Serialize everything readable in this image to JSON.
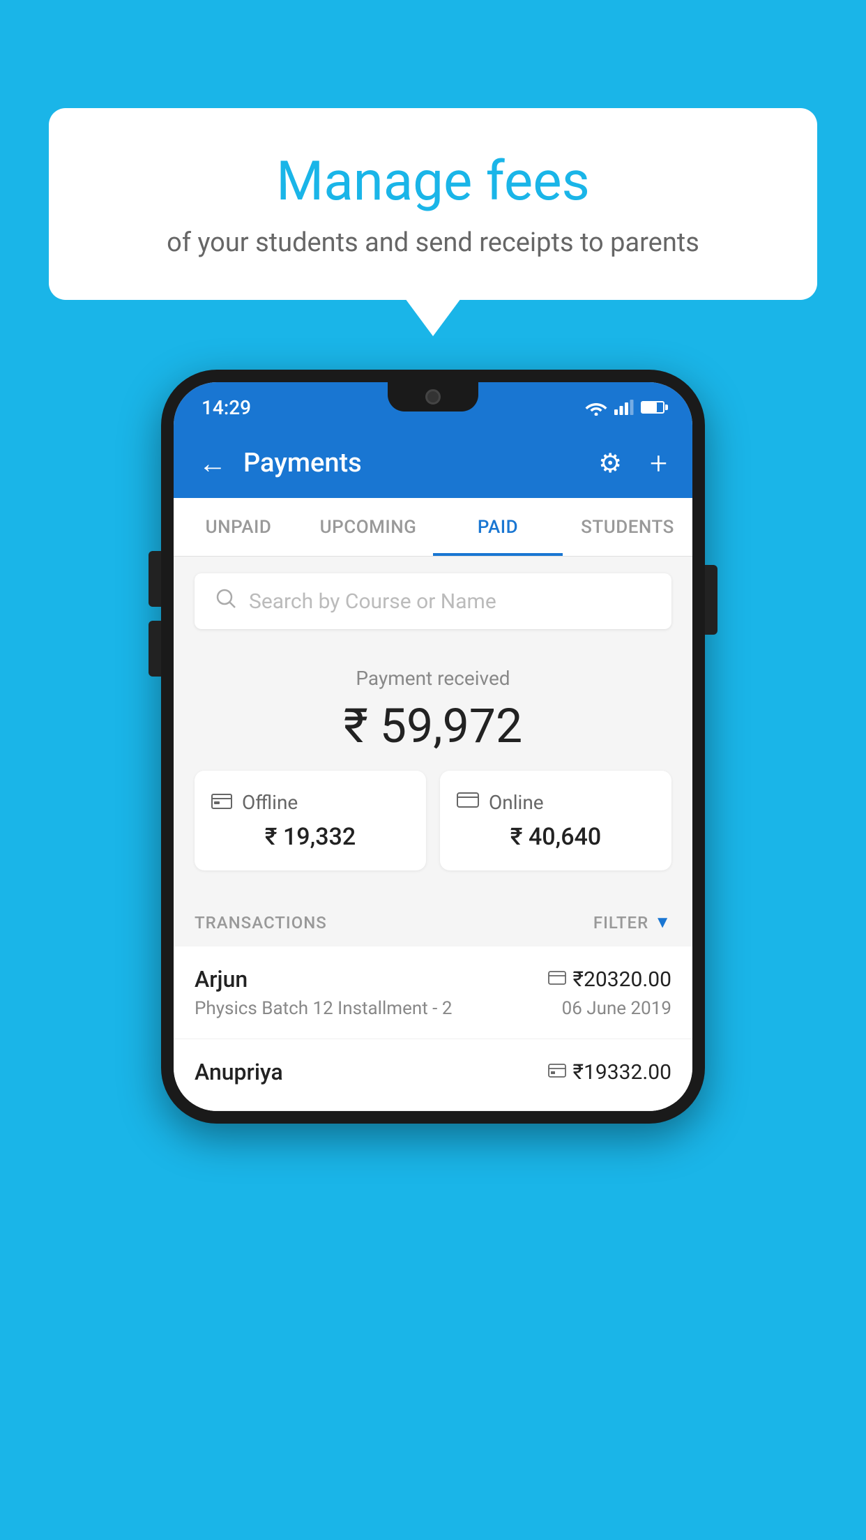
{
  "background": {
    "color": "#1ab5e8"
  },
  "speech_bubble": {
    "title": "Manage fees",
    "subtitle": "of your students and send receipts to parents"
  },
  "status_bar": {
    "time": "14:29"
  },
  "app_header": {
    "title": "Payments",
    "back_label": "←",
    "settings_label": "⚙",
    "add_label": "+"
  },
  "tabs": [
    {
      "label": "UNPAID",
      "active": false
    },
    {
      "label": "UPCOMING",
      "active": false
    },
    {
      "label": "PAID",
      "active": true
    },
    {
      "label": "STUDENTS",
      "active": false
    }
  ],
  "search": {
    "placeholder": "Search by Course or Name"
  },
  "payment_summary": {
    "label": "Payment received",
    "amount": "₹ 59,972",
    "offline": {
      "label": "Offline",
      "amount": "₹ 19,332"
    },
    "online": {
      "label": "Online",
      "amount": "₹ 40,640"
    }
  },
  "transactions_section": {
    "label": "TRANSACTIONS",
    "filter_label": "FILTER"
  },
  "transactions": [
    {
      "name": "Arjun",
      "amount": "₹20320.00",
      "type": "online",
      "course": "Physics Batch 12 Installment - 2",
      "date": "06 June 2019"
    },
    {
      "name": "Anupriya",
      "amount": "₹19332.00",
      "type": "offline",
      "course": "",
      "date": ""
    }
  ]
}
